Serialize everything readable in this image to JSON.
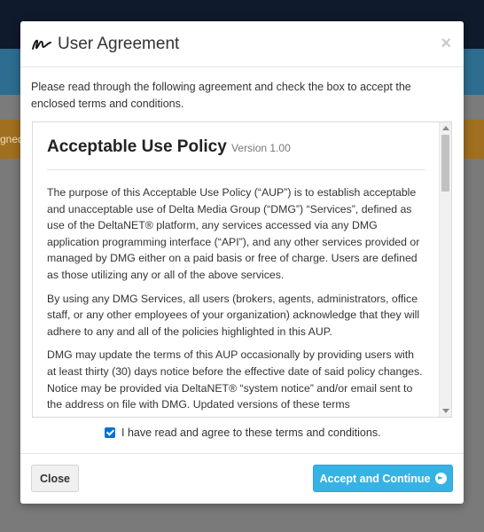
{
  "background": {
    "banner_fragment": "gned"
  },
  "modal": {
    "title": "User Agreement",
    "close_symbol": "×",
    "logo_icon": "signature-icon",
    "intro": "Please read through the following agreement and check the box to accept the enclosed terms and conditions.",
    "policy": {
      "heading": "Acceptable Use Policy",
      "version": "Version 1.00",
      "paragraphs": [
        "The purpose of this Acceptable Use Policy (“AUP”) is to establish acceptable and unacceptable use of Delta Media Group (“DMG”) “Services”, defined as use of the DeltaNET® platform, any services accessed via any DMG application programming interface (“API”), and any other services provided or managed by DMG either on a paid basis or free of charge. Users are defined as those utilizing any or all of the above services.",
        "By using any DMG Services, all users (brokers, agents, administrators, office staff, or any other employees of your organization) acknowledge that they will adhere to any and all of the policies highlighted in this AUP.",
        "DMG may update the terms of this AUP occasionally by providing users with at least thirty (30) days notice before the effective date of said policy changes. Notice may be provided via DeltaNET® “system notice” and/or email sent to the address on file with DMG. Updated versions of these terms"
      ]
    },
    "agree_checked": true,
    "agree_label": "I have read and agree to these terms and conditions.",
    "buttons": {
      "close": "Close",
      "accept": "Accept and Continue"
    },
    "colors": {
      "accept_button": "#36b3e4",
      "checkbox": "#0a72d6"
    }
  }
}
